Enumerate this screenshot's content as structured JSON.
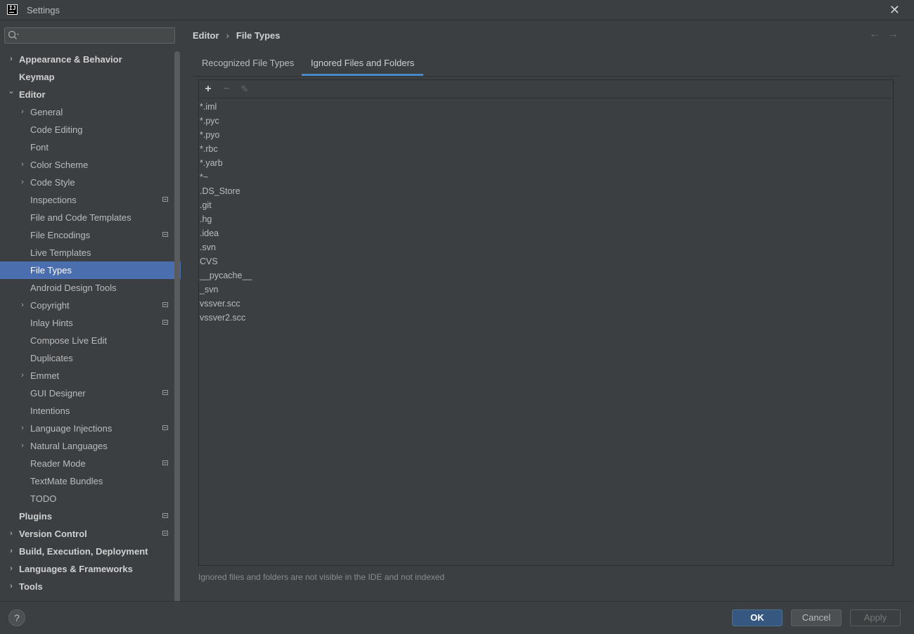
{
  "window": {
    "title": "Settings"
  },
  "search": {
    "placeholder": "",
    "value": ""
  },
  "sidebar": {
    "items": [
      {
        "label": "Appearance & Behavior",
        "level": 0,
        "expandable": true,
        "expanded": false,
        "badge": false,
        "selected": false
      },
      {
        "label": "Keymap",
        "level": 0,
        "expandable": false,
        "expanded": false,
        "badge": false,
        "selected": false
      },
      {
        "label": "Editor",
        "level": 0,
        "expandable": true,
        "expanded": true,
        "badge": false,
        "selected": false
      },
      {
        "label": "General",
        "level": 1,
        "expandable": true,
        "expanded": false,
        "badge": false,
        "selected": false
      },
      {
        "label": "Code Editing",
        "level": 1,
        "expandable": false,
        "expanded": false,
        "badge": false,
        "selected": false
      },
      {
        "label": "Font",
        "level": 1,
        "expandable": false,
        "expanded": false,
        "badge": false,
        "selected": false
      },
      {
        "label": "Color Scheme",
        "level": 1,
        "expandable": true,
        "expanded": false,
        "badge": false,
        "selected": false
      },
      {
        "label": "Code Style",
        "level": 1,
        "expandable": true,
        "expanded": false,
        "badge": false,
        "selected": false
      },
      {
        "label": "Inspections",
        "level": 1,
        "expandable": false,
        "expanded": false,
        "badge": true,
        "selected": false
      },
      {
        "label": "File and Code Templates",
        "level": 1,
        "expandable": false,
        "expanded": false,
        "badge": false,
        "selected": false
      },
      {
        "label": "File Encodings",
        "level": 1,
        "expandable": false,
        "expanded": false,
        "badge": true,
        "selected": false
      },
      {
        "label": "Live Templates",
        "level": 1,
        "expandable": false,
        "expanded": false,
        "badge": false,
        "selected": false
      },
      {
        "label": "File Types",
        "level": 1,
        "expandable": false,
        "expanded": false,
        "badge": false,
        "selected": true
      },
      {
        "label": "Android Design Tools",
        "level": 1,
        "expandable": false,
        "expanded": false,
        "badge": false,
        "selected": false
      },
      {
        "label": "Copyright",
        "level": 1,
        "expandable": true,
        "expanded": false,
        "badge": true,
        "selected": false
      },
      {
        "label": "Inlay Hints",
        "level": 1,
        "expandable": false,
        "expanded": false,
        "badge": true,
        "selected": false
      },
      {
        "label": "Compose Live Edit",
        "level": 1,
        "expandable": false,
        "expanded": false,
        "badge": false,
        "selected": false
      },
      {
        "label": "Duplicates",
        "level": 1,
        "expandable": false,
        "expanded": false,
        "badge": false,
        "selected": false
      },
      {
        "label": "Emmet",
        "level": 1,
        "expandable": true,
        "expanded": false,
        "badge": false,
        "selected": false
      },
      {
        "label": "GUI Designer",
        "level": 1,
        "expandable": false,
        "expanded": false,
        "badge": true,
        "selected": false
      },
      {
        "label": "Intentions",
        "level": 1,
        "expandable": false,
        "expanded": false,
        "badge": false,
        "selected": false
      },
      {
        "label": "Language Injections",
        "level": 1,
        "expandable": true,
        "expanded": false,
        "badge": true,
        "selected": false
      },
      {
        "label": "Natural Languages",
        "level": 1,
        "expandable": true,
        "expanded": false,
        "badge": false,
        "selected": false
      },
      {
        "label": "Reader Mode",
        "level": 1,
        "expandable": false,
        "expanded": false,
        "badge": true,
        "selected": false
      },
      {
        "label": "TextMate Bundles",
        "level": 1,
        "expandable": false,
        "expanded": false,
        "badge": false,
        "selected": false
      },
      {
        "label": "TODO",
        "level": 1,
        "expandable": false,
        "expanded": false,
        "badge": false,
        "selected": false
      },
      {
        "label": "Plugins",
        "level": 0,
        "expandable": false,
        "expanded": false,
        "badge": true,
        "selected": false
      },
      {
        "label": "Version Control",
        "level": 0,
        "expandable": true,
        "expanded": false,
        "badge": true,
        "selected": false
      },
      {
        "label": "Build, Execution, Deployment",
        "level": 0,
        "expandable": true,
        "expanded": false,
        "badge": false,
        "selected": false
      },
      {
        "label": "Languages & Frameworks",
        "level": 0,
        "expandable": true,
        "expanded": false,
        "badge": false,
        "selected": false
      },
      {
        "label": "Tools",
        "level": 0,
        "expandable": true,
        "expanded": false,
        "badge": false,
        "selected": false
      }
    ]
  },
  "breadcrumb": {
    "parent": "Editor",
    "separator": "›",
    "current": "File Types"
  },
  "nav": {
    "back": "←",
    "forward": "→"
  },
  "tabs": [
    {
      "label": "Recognized File Types",
      "active": false
    },
    {
      "label": "Ignored Files and Folders",
      "active": true
    }
  ],
  "toolbar": {
    "add": "+",
    "remove": "−",
    "edit": "✎"
  },
  "ignored": [
    "*.iml",
    "*.pyc",
    "*.pyo",
    "*.rbc",
    "*.yarb",
    "*~",
    ".DS_Store",
    ".git",
    ".hg",
    ".idea",
    ".svn",
    "CVS",
    "__pycache__",
    "_svn",
    "vssver.scc",
    "vssver2.scc"
  ],
  "hint": "Ignored files and folders are not visible in the IDE and not indexed",
  "footer": {
    "help": "?",
    "ok": "OK",
    "cancel": "Cancel",
    "apply": "Apply"
  },
  "colors": {
    "accent": "#4b6eaf",
    "tab_underline": "#4a88c7",
    "ok_button": "#365880",
    "background": "#3c3f41"
  }
}
